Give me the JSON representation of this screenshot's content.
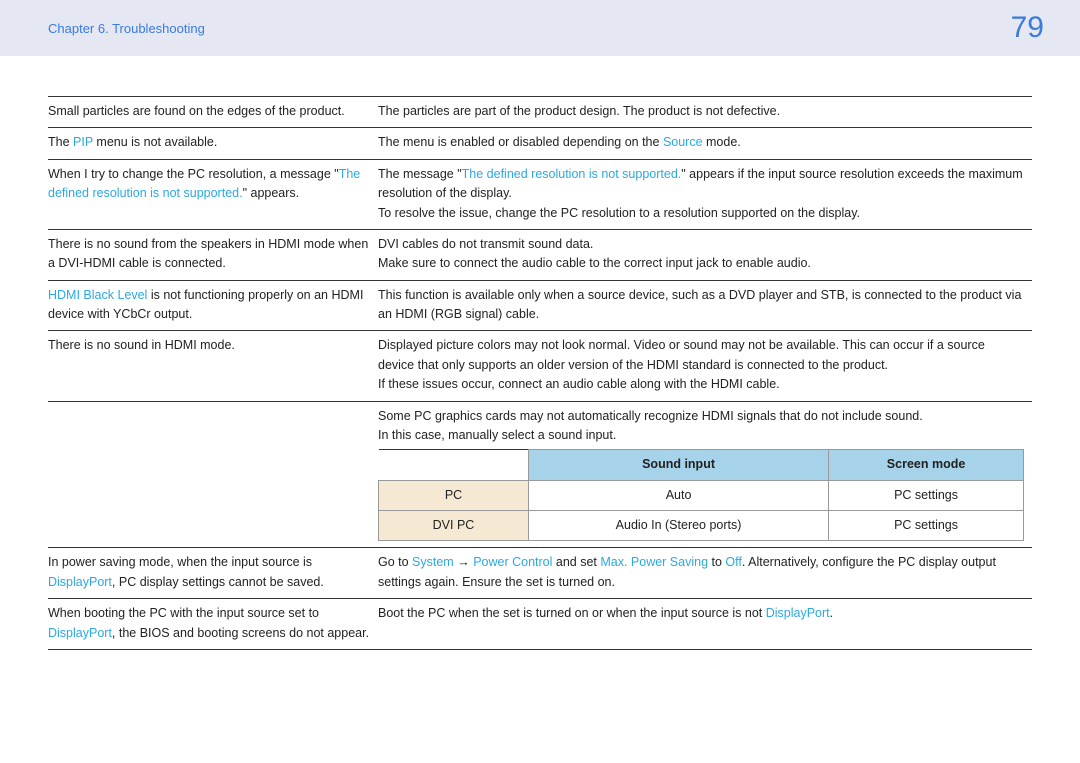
{
  "header": {
    "chapter": "Chapter 6. Troubleshooting",
    "page": "79"
  },
  "rows": [
    {
      "left": [
        [
          {
            "t": "Small particles are found on the edges of the product."
          }
        ]
      ],
      "right": [
        [
          {
            "t": "The particles are part of the product design. The product is not defective."
          }
        ]
      ]
    },
    {
      "left": [
        [
          {
            "t": "The "
          },
          {
            "t": "PIP",
            "hl": true
          },
          {
            "t": " menu is not available."
          }
        ]
      ],
      "right": [
        [
          {
            "t": "The menu is enabled or disabled depending on the "
          },
          {
            "t": "Source",
            "hl": true
          },
          {
            "t": " mode."
          }
        ]
      ]
    },
    {
      "left": [
        [
          {
            "t": "When I try to change the PC resolution, a message \""
          },
          {
            "t": "The defined resolution is not supported.",
            "hl": true
          },
          {
            "t": "\" appears."
          }
        ]
      ],
      "right": [
        [
          {
            "t": "The message \""
          },
          {
            "t": "The defined resolution is not supported.",
            "hl": true
          },
          {
            "t": "\" appears if the input source resolution exceeds the maximum resolution of the display."
          }
        ],
        [
          {
            "t": "To resolve the issue, change the PC resolution to a resolution supported on the display."
          }
        ]
      ]
    },
    {
      "left": [
        [
          {
            "t": "There is no sound from the speakers in HDMI mode when a DVI-HDMI cable is connected."
          }
        ]
      ],
      "right": [
        [
          {
            "t": "DVI cables do not transmit sound data."
          }
        ],
        [
          {
            "t": "Make sure to connect the audio cable to the correct input jack to enable audio."
          }
        ]
      ]
    },
    {
      "left": [
        [
          {
            "t": "HDMI Black Level",
            "hl": true
          },
          {
            "t": " is not functioning properly on an HDMI device with YCbCr output."
          }
        ]
      ],
      "right": [
        [
          {
            "t": "This function is available only when a source device, such as a DVD player and STB, is connected to the product via an HDMI (RGB signal) cable."
          }
        ]
      ]
    },
    {
      "left": [
        [
          {
            "t": "There is no sound in HDMI mode."
          }
        ]
      ],
      "right": [
        [
          {
            "t": "Displayed picture colors may not look normal. Video or sound may not be available. This can occur if a source device that only supports an older version of the HDMI standard is connected to the product."
          }
        ],
        [
          {
            "t": "If these issues occur, connect an audio cable along with the HDMI cable."
          }
        ]
      ]
    },
    {
      "left": [],
      "right": [
        [
          {
            "t": "Some PC graphics cards may not automatically recognize HDMI signals that do not include sound."
          }
        ],
        [
          {
            "t": "In this case, manually select a sound input."
          }
        ]
      ],
      "inner_table": {
        "headers": [
          "",
          "Sound input",
          "Screen mode"
        ],
        "rows": [
          {
            "label": "PC",
            "c1": "Auto",
            "c2": "PC settings"
          },
          {
            "label": "DVI PC",
            "c1": "Audio In (Stereo ports)",
            "c2": "PC settings"
          }
        ]
      }
    },
    {
      "left": [
        [
          {
            "t": "In power saving mode, when the input source is "
          },
          {
            "t": "DisplayPort",
            "hl": true
          },
          {
            "t": ", PC display settings cannot be saved."
          }
        ]
      ],
      "right": [
        [
          {
            "t": "Go to "
          },
          {
            "t": "System",
            "hl": true
          },
          {
            "t": " → ",
            "arrow": true
          },
          {
            "t": "Power Control",
            "hl": true
          },
          {
            "t": " and set "
          },
          {
            "t": "Max. Power Saving",
            "hl": true
          },
          {
            "t": " to "
          },
          {
            "t": "Off",
            "hl": true
          },
          {
            "t": ". Alternatively, configure the PC display output settings again. Ensure the set is turned on."
          }
        ]
      ]
    },
    {
      "left": [
        [
          {
            "t": "When booting the PC with the input source set to "
          },
          {
            "t": "DisplayPort",
            "hl": true
          },
          {
            "t": ", the BIOS and booting screens do not appear."
          }
        ]
      ],
      "right": [
        [
          {
            "t": "Boot the PC when the set is turned on or when the input source is not "
          },
          {
            "t": "DisplayPort",
            "hl": true
          },
          {
            "t": "."
          }
        ]
      ]
    }
  ]
}
